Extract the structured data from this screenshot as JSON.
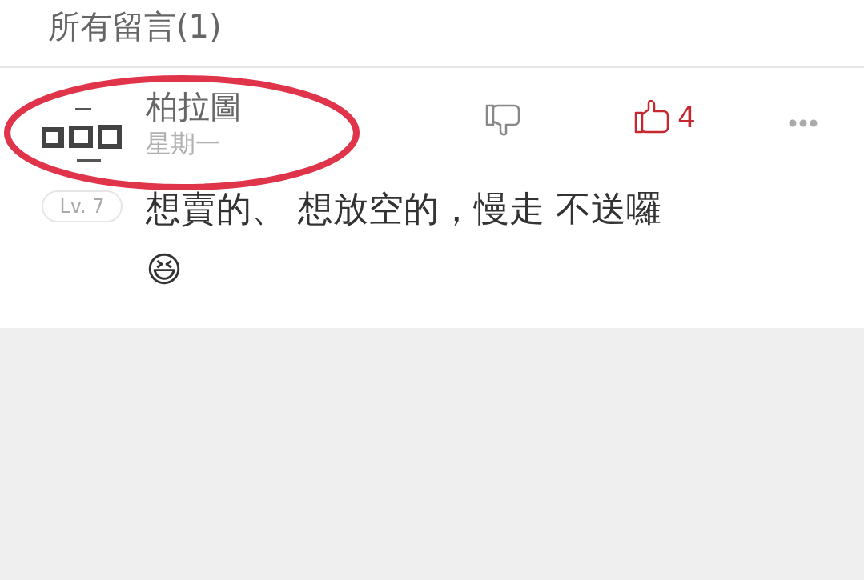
{
  "header": {
    "title": "所有留言(1)"
  },
  "comment": {
    "author": "柏拉圖",
    "date": "星期一",
    "level_badge": "Lv. 7",
    "text": "想賣的、 想放空的，慢走 不送囉 😆",
    "disliked": false,
    "liked": true,
    "like_count": "4",
    "highlighted": true
  }
}
